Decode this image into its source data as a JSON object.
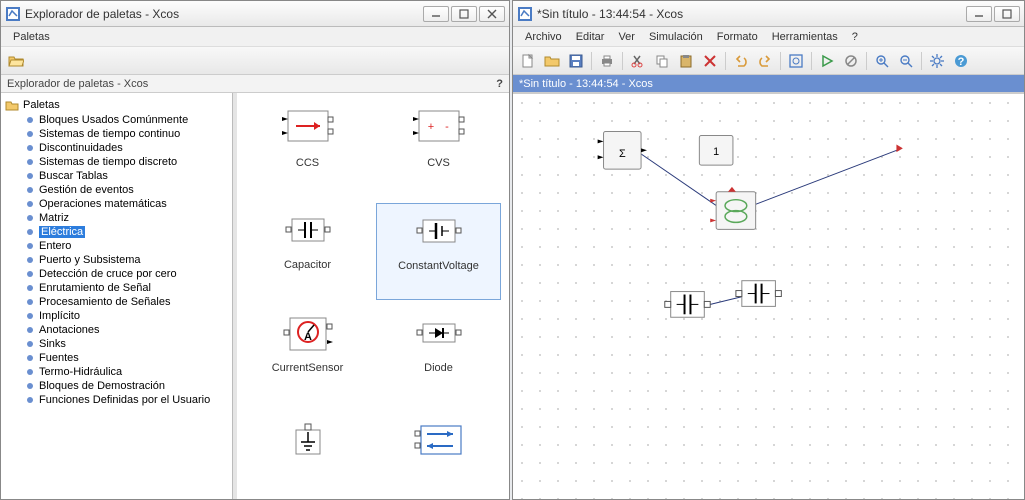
{
  "left_window": {
    "title": "Explorador de paletas - Xcos",
    "menu": {
      "paletas": "Paletas"
    },
    "subtitle": "Explorador de paletas - Xcos",
    "help_label": "?",
    "tree_root": "Paletas",
    "tree_items": [
      "Bloques Usados Comúnmente",
      "Sistemas de tiempo continuo",
      "Discontinuidades",
      "Sistemas de tiempo discreto",
      "Buscar Tablas",
      "Gestión de eventos",
      "Operaciones matemáticas",
      "Matriz",
      "Eléctrica",
      "Entero",
      "Puerto y Subsistema",
      "Detección de cruce por cero",
      "Enrutamiento de Señal",
      "Procesamiento de Señales",
      "Implícito",
      "Anotaciones",
      "Sinks",
      "Fuentes",
      "Termo-Hidráulica",
      "Bloques de Demostración",
      "Funciones Definidas por el Usuario"
    ],
    "selected_tree_index": 8,
    "palette": [
      {
        "label": "CCS"
      },
      {
        "label": "CVS"
      },
      {
        "label": "Capacitor"
      },
      {
        "label": "ConstantVoltage",
        "selected": true
      },
      {
        "label": "CurrentSensor"
      },
      {
        "label": "Diode"
      },
      {
        "label": ""
      },
      {
        "label": ""
      }
    ]
  },
  "right_window": {
    "title": "*Sin título - 13:44:54 - Xcos",
    "menu": {
      "archivo": "Archivo",
      "editar": "Editar",
      "ver": "Ver",
      "simulacion": "Simulación",
      "formato": "Formato",
      "herramientas": "Herramientas",
      "help": "?"
    },
    "subtitle": "*Sin título - 13:44:54 - Xcos",
    "canvas_blocks": {
      "sum_label": "Σ",
      "const_label": "1"
    }
  }
}
